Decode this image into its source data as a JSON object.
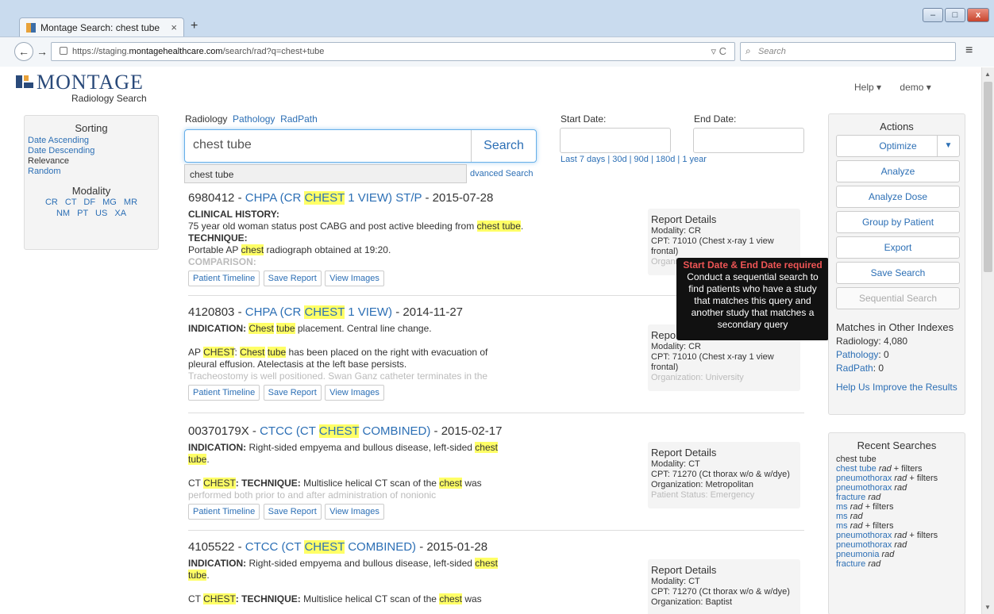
{
  "browser": {
    "tab_title": "Montage Search: chest tube",
    "tab_close": "×",
    "new_tab": "+",
    "url_prefix": "https://staging.",
    "url_host": "montagehealthcare.com",
    "url_path": "/search/rad?q=chest+tube",
    "search_placeholder": "Search",
    "win_min": "–",
    "win_max": "□",
    "win_close": "x"
  },
  "header": {
    "logo_text": "MONTAGE",
    "logo_sub": "Radiology Search",
    "help": "Help ▾",
    "user": "demo ▾"
  },
  "sorting": {
    "title": "Sorting",
    "items": [
      "Date Ascending",
      "Date Descending",
      "Relevance",
      "Random"
    ],
    "modality_title": "Modality",
    "modalities_row1": "CR CT DF MG MR",
    "modalities_row2": "NM PT US XA"
  },
  "search": {
    "tabs": [
      "Radiology",
      "Pathology",
      "RadPath"
    ],
    "query": "chest tube",
    "button": "Search",
    "suggestion": "chest tube",
    "advanced": "dvanced Search",
    "start_label": "Start Date:",
    "end_label": "End Date:",
    "quick_dates": "Last 7 days | 30d | 90d | 180d | 1 year"
  },
  "results": [
    {
      "id": "6980412 - ",
      "cat_a": "CHPA (CR ",
      "hl": "CHEST",
      "cat_b": " 1 VIEW) ST/P",
      "date": " - 2015-07-28",
      "line1_label": "CLINICAL HISTORY:",
      "line2": "75 year old woman status post CABG and post active bleeding from ",
      "line2_hl": "chest tube",
      "line3_label": "TECHNIQUE:",
      "line4_a": "Portable AP ",
      "line4_hl": "chest",
      "line4_b": " radiograph obtained at 19:20.",
      "line5": "COMPARISON:",
      "details": [
        "Report Details",
        "Modality: CR",
        "CPT: 71010 (Chest x-ray 1 view",
        "frontal)",
        "Organization: University"
      ]
    },
    {
      "id": "4120803 - ",
      "cat_a": "CHPA (CR ",
      "hl": "CHEST",
      "cat_b": " 1 VIEW)",
      "date": " - 2014-11-27",
      "line1_label": "INDICATION:",
      "line1_hl_a": "Chest",
      "line1_hl_b": "tube",
      "line1_rest": " placement. Central line change.",
      "line2_hl_a": "CHEST",
      "line2_hl_b": "Chest",
      "line2_hl_c": "tube",
      "line2_a": "AP ",
      "line2_b": ": ",
      "line2_c": " has been placed on the right with evacuation of",
      "line3": "pleural effusion. Atelectasis at the left base persists.",
      "line4": "Tracheostomy is well positioned. Swan Ganz catheter terminates in the",
      "details": [
        "Report Details",
        "Modality: CR",
        "CPT: 71010 (Chest x-ray 1 view",
        "frontal)",
        "Organization: University"
      ]
    },
    {
      "id": "00370179X - ",
      "cat_a": "CTCC (CT ",
      "hl": "CHEST",
      "cat_b": " COMBINED)",
      "date": " - 2015-02-17",
      "line1_label": "INDICATION:",
      "line1_rest": " Right-sided empyema and bullous disease, left-sided ",
      "line1_hl": "chest",
      "line2_hl": "tube",
      "line3_a": "CT ",
      "line3_hl": "CHEST",
      "line3_label": ": TECHNIQUE:",
      "line3_b": " Multislice helical CT scan of the ",
      "line3_hl2": "chest",
      "line3_c": " was",
      "line4": "performed both prior to and after administration of nonionic",
      "details": [
        "Report Details",
        "Modality: CT",
        "CPT: 71270 (Ct thorax w/o & w/dye)",
        "Organization: Metropolitan",
        "Patient Status: Emergency"
      ]
    },
    {
      "id": "4105522 - ",
      "cat_a": "CTCC (CT ",
      "hl": "CHEST",
      "cat_b": " COMBINED)",
      "date": " - 2015-01-28",
      "line1_label": "INDICATION:",
      "line1_rest": " Right-sided empyema and bullous disease, left-sided ",
      "line1_hl": "chest",
      "line2_hl": "tube",
      "line3_a": "CT ",
      "line3_hl": "CHEST",
      "line3_label": ": TECHNIQUE:",
      "line3_b": " Multislice helical CT scan of the ",
      "line3_hl2": "chest",
      "line3_c": " was",
      "details": [
        "Report Details",
        "Modality: CT",
        "CPT: 71270 (Ct thorax w/o & w/dye)",
        "Organization: Baptist"
      ]
    }
  ],
  "result_buttons": [
    "Patient Timeline",
    "Save Report",
    "View Images"
  ],
  "tooltip": {
    "head": "Start Date & End Date required",
    "body": "Conduct a sequential search to find patients who have a study that matches this query and another study that matches a secondary query"
  },
  "actions": {
    "title": "Actions",
    "buttons": [
      "Optimize",
      "Analyze",
      "Analyze Dose",
      "Group by Patient",
      "Export",
      "Save Search",
      "Sequential Search"
    ],
    "matches_title": "Matches in Other Indexes",
    "radiology": "Radiology: 4,080",
    "pathology_label": "Pathology",
    "pathology_val": ": 0",
    "radpath_label": "RadPath",
    "radpath_val": ": 0",
    "improve": "Help Us Improve the Results"
  },
  "recent": {
    "title": "Recent Searches",
    "first": "chest tube",
    "items": [
      {
        "q": "chest tube",
        "t": "rad",
        "f": " + filters"
      },
      {
        "q": "pneumothorax",
        "t": "rad",
        "f": " + filters"
      },
      {
        "q": "pneumothorax",
        "t": "rad",
        "f": ""
      },
      {
        "q": "fracture",
        "t": "rad",
        "f": ""
      },
      {
        "q": "ms",
        "t": "rad",
        "f": " + filters"
      },
      {
        "q": "ms",
        "t": "rad",
        "f": ""
      },
      {
        "q": "ms",
        "t": "rad",
        "f": " + filters"
      },
      {
        "q": "pneumothorax",
        "t": "rad",
        "f": " + filters"
      },
      {
        "q": "pneumothorax",
        "t": "rad",
        "f": ""
      },
      {
        "q": "pneumonia",
        "t": "rad",
        "f": ""
      },
      {
        "q": "fracture",
        "t": "rad",
        "f": ""
      }
    ]
  }
}
